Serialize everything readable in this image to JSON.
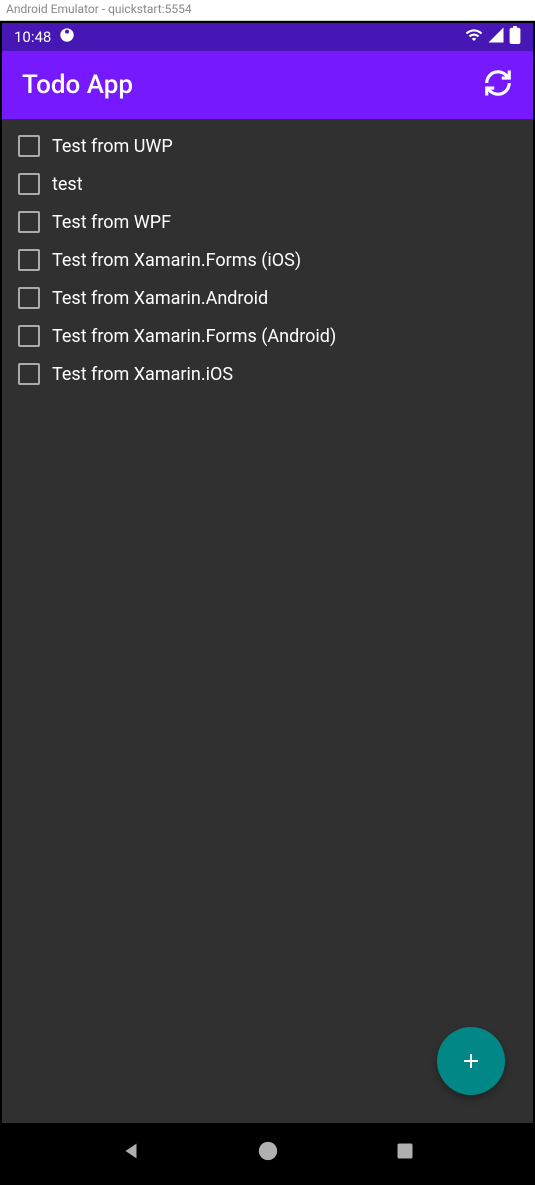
{
  "emulator": {
    "title": "Android Emulator - quickstart:5554"
  },
  "statusBar": {
    "time": "10:48"
  },
  "appBar": {
    "title": "Todo App"
  },
  "todos": [
    {
      "label": "Test from UWP",
      "checked": false
    },
    {
      "label": "test",
      "checked": false
    },
    {
      "label": "Test from WPF",
      "checked": false
    },
    {
      "label": "Test from Xamarin.Forms (iOS)",
      "checked": false
    },
    {
      "label": "Test from Xamarin.Android",
      "checked": false
    },
    {
      "label": "Test from Xamarin.Forms (Android)",
      "checked": false
    },
    {
      "label": "Test from Xamarin.iOS",
      "checked": false
    }
  ],
  "colors": {
    "statusBar": "#4617b4",
    "appBar": "#7719ff",
    "background": "#303030",
    "fab": "#018786"
  }
}
